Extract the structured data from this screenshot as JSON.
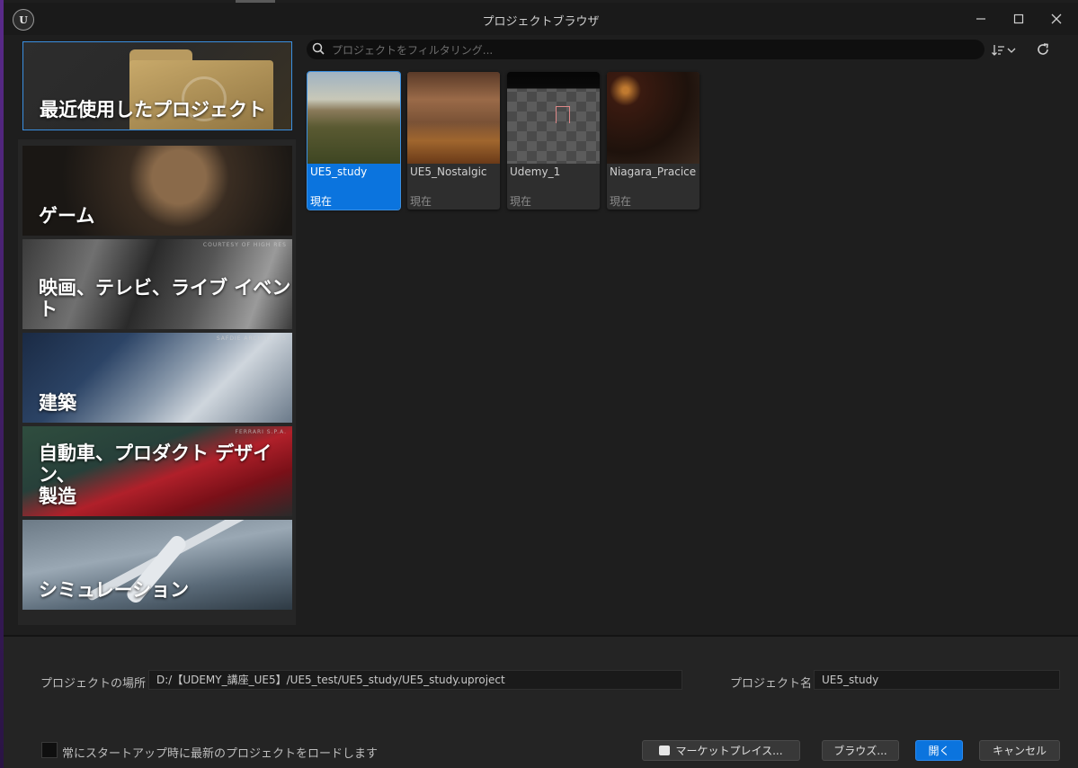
{
  "window": {
    "title": "プロジェクトブラウザ",
    "logo_text": "U"
  },
  "categories": {
    "recent": "最近使用したプロジェクト",
    "game": "ゲーム",
    "film": "映画、テレビ、ライブ イベント",
    "film_credit": "COURTESY OF HIGH RES",
    "architecture": "建築",
    "architecture_credit": "SAFDIE ARCHITECTS",
    "automotive_line1": "自動車、プロダクト デザイン、",
    "automotive_line2": "製造",
    "automotive_credit": "FERRARI S.P.A.",
    "simulation": "シミュレーション"
  },
  "search": {
    "placeholder": "プロジェクトをフィルタリング..."
  },
  "icons": {
    "sort": "sort-icon",
    "refresh": "refresh-icon",
    "search": "search-icon"
  },
  "projects": [
    {
      "name": "UE5_study",
      "status": "現在",
      "selected": true
    },
    {
      "name": "UE5_Nostalgic",
      "status": "現在",
      "selected": false
    },
    {
      "name": "Udemy_1",
      "status": "現在",
      "selected": false
    },
    {
      "name": "Niagara_Pracice",
      "status": "現在",
      "selected": false
    }
  ],
  "footer": {
    "location_label": "プロジェクトの場所",
    "location_value": "D:/【UDEMY_講座_UE5】/UE5_test/UE5_study/UE5_study.uproject",
    "name_label": "プロジェクト名",
    "name_value": "UE5_study",
    "startup_checkbox_label": "常にスタートアップ時に最新のプロジェクトをロードします",
    "marketplace_button": "マーケットプレイス...",
    "browse_button": "ブラウズ...",
    "open_button": "開く",
    "cancel_button": "キャンセル"
  },
  "colors": {
    "accent": "#0b74de",
    "background": "#1e1e1e"
  }
}
